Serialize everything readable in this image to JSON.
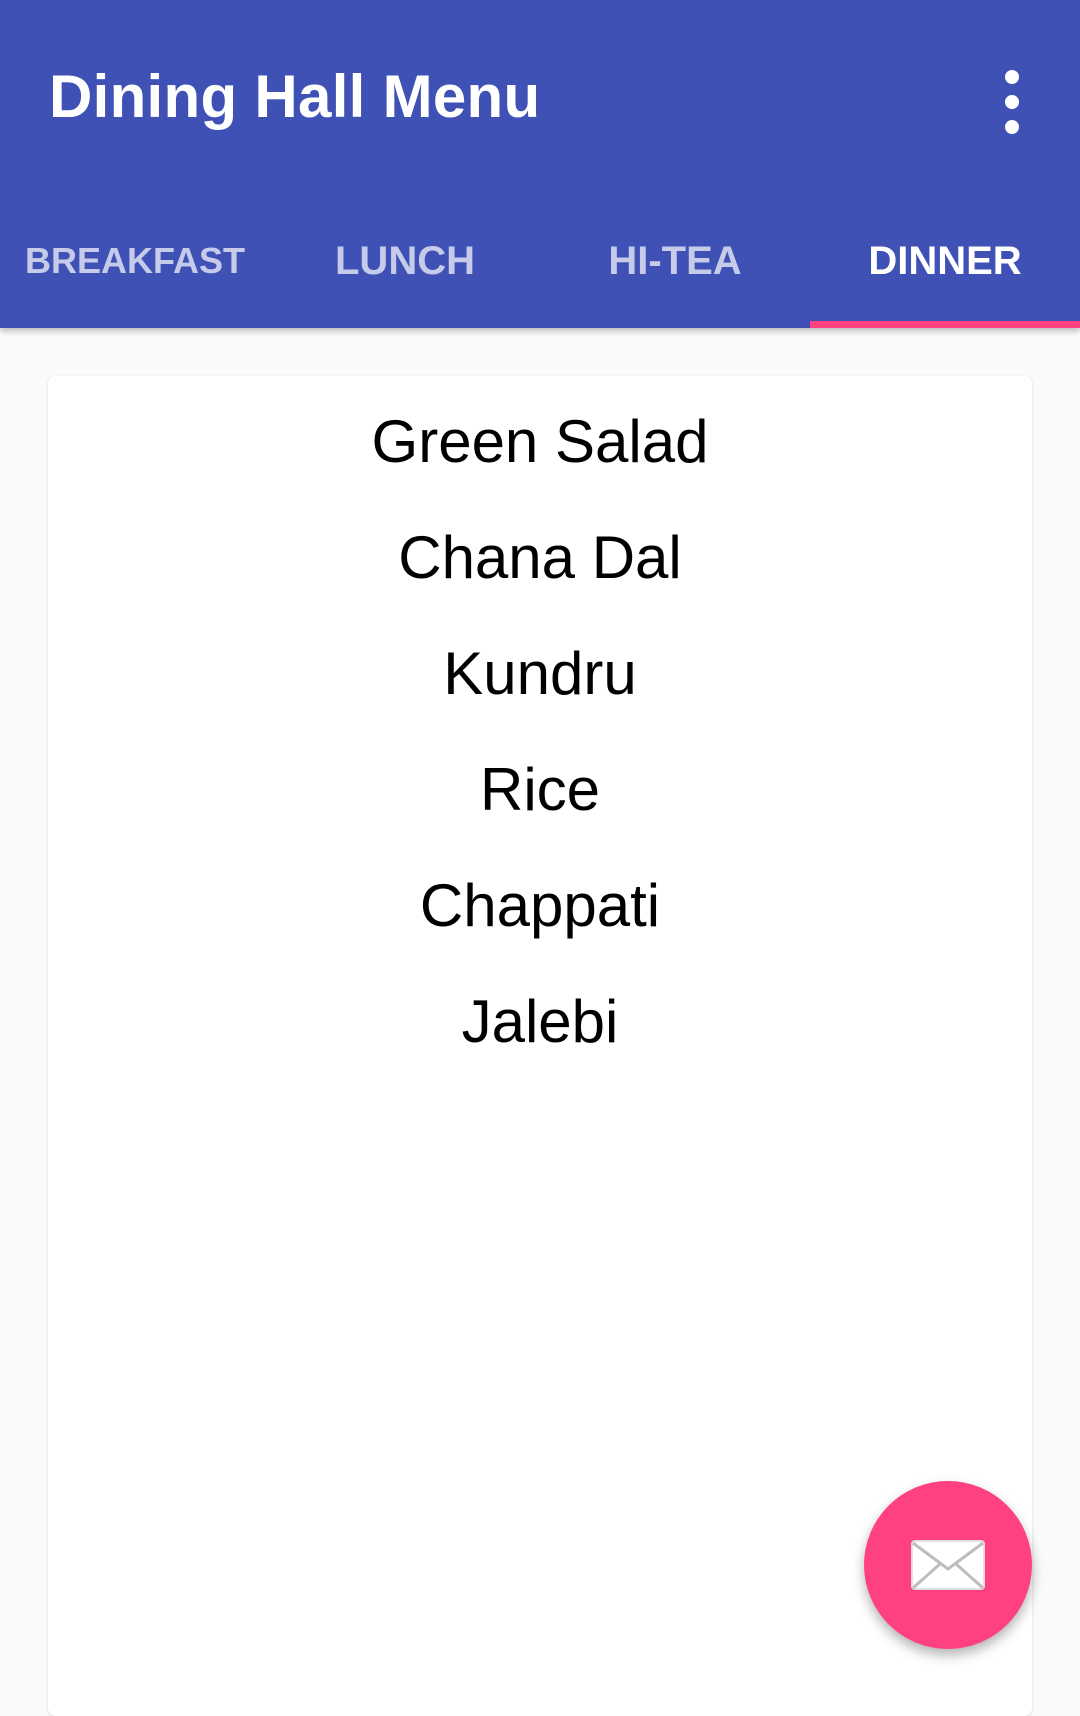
{
  "app_bar": {
    "title": "Dining Hall Menu",
    "overflow_icon": "more-vert-icon",
    "background_color": "#3f51b5"
  },
  "tabs": [
    {
      "label": "BREAKFAST",
      "selected": false
    },
    {
      "label": "LUNCH",
      "selected": false
    },
    {
      "label": "HI-TEA",
      "selected": false
    },
    {
      "label": "DINNER",
      "selected": true
    }
  ],
  "tab_indicator_color": "#ff4081",
  "menu": {
    "items": [
      "Green Salad",
      "Chana Dal",
      "Kundru",
      "Rice",
      "Chappati",
      "Jalebi"
    ]
  },
  "fab": {
    "icon": "email-icon",
    "color": "#ff4081"
  }
}
